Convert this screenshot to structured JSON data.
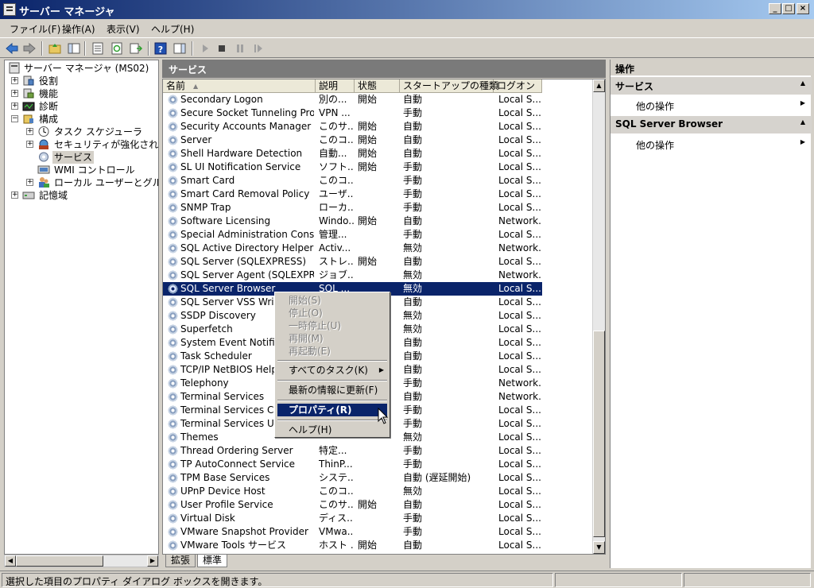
{
  "window": {
    "title": "サーバー マネージャ"
  },
  "menubar": [
    "ファイル(F)",
    "操作(A)",
    "表示(V)",
    "ヘルプ(H)"
  ],
  "tree": {
    "root": "サーバー マネージャ (MS02)",
    "roles": "役割",
    "features": "機能",
    "diagnostics": "診断",
    "config": "構成",
    "task_scheduler": "タスク スケジューラ",
    "firewall": "セキュリティが強化された Wi",
    "services": "サービス",
    "wmi": "WMI コントロール",
    "local_users": "ローカル ユーザーとグループ",
    "storage": "記憶域"
  },
  "center": {
    "header": "サービス",
    "columns": {
      "name": "名前",
      "desc": "説明",
      "status": "状態",
      "startup": "スタートアップの種類",
      "logon": "ログオン"
    },
    "rows": [
      {
        "name": "Secondary Logon",
        "desc": "別の...",
        "status": "開始",
        "startup": "自動",
        "logon": "Local S..."
      },
      {
        "name": "Secure Socket Tunneling Proto...",
        "desc": "VPN ...",
        "status": "",
        "startup": "手動",
        "logon": "Local S..."
      },
      {
        "name": "Security Accounts Manager",
        "desc": "このサ...",
        "status": "開始",
        "startup": "自動",
        "logon": "Local S..."
      },
      {
        "name": "Server",
        "desc": "このコ...",
        "status": "開始",
        "startup": "自動",
        "logon": "Local S..."
      },
      {
        "name": "Shell Hardware Detection",
        "desc": "自動...",
        "status": "開始",
        "startup": "自動",
        "logon": "Local S..."
      },
      {
        "name": "SL UI Notification Service",
        "desc": "ソフト...",
        "status": "開始",
        "startup": "手動",
        "logon": "Local S..."
      },
      {
        "name": "Smart Card",
        "desc": "このコ...",
        "status": "",
        "startup": "手動",
        "logon": "Local S..."
      },
      {
        "name": "Smart Card Removal Policy",
        "desc": "ユーザ...",
        "status": "",
        "startup": "手動",
        "logon": "Local S..."
      },
      {
        "name": "SNMP Trap",
        "desc": "ローカ...",
        "status": "",
        "startup": "手動",
        "logon": "Local S..."
      },
      {
        "name": "Software Licensing",
        "desc": "Windo...",
        "status": "開始",
        "startup": "自動",
        "logon": "Network..."
      },
      {
        "name": "Special Administration Console...",
        "desc": "管理...",
        "status": "",
        "startup": "手動",
        "logon": "Local S..."
      },
      {
        "name": "SQL Active Directory Helper S...",
        "desc": "Activ...",
        "status": "",
        "startup": "無効",
        "logon": "Network..."
      },
      {
        "name": "SQL Server (SQLEXPRESS)",
        "desc": "ストレ...",
        "status": "開始",
        "startup": "自動",
        "logon": "Local S..."
      },
      {
        "name": "SQL Server Agent (SQLEXPRE...",
        "desc": "ジョブ...",
        "status": "",
        "startup": "無効",
        "logon": "Network..."
      },
      {
        "name": "SQL Server Browser",
        "desc": "SQL ...",
        "status": "",
        "startup": "無効",
        "logon": "Local S..."
      },
      {
        "name": "SQL Server VSS Writer",
        "desc": "",
        "status": "",
        "startup": "自動",
        "logon": "Local S..."
      },
      {
        "name": "SSDP Discovery",
        "desc": "",
        "status": "",
        "startup": "無効",
        "logon": "Local S..."
      },
      {
        "name": "Superfetch",
        "desc": "",
        "status": "",
        "startup": "無効",
        "logon": "Local S..."
      },
      {
        "name": "System Event Notificat",
        "desc": "",
        "status": "",
        "startup": "自動",
        "logon": "Local S..."
      },
      {
        "name": "Task Scheduler",
        "desc": "",
        "status": "",
        "startup": "自動",
        "logon": "Local S..."
      },
      {
        "name": "TCP/IP NetBIOS Helpe",
        "desc": "",
        "status": "",
        "startup": "自動",
        "logon": "Local S..."
      },
      {
        "name": "Telephony",
        "desc": "",
        "status": "",
        "startup": "手動",
        "logon": "Network..."
      },
      {
        "name": "Terminal Services",
        "desc": "",
        "status": "",
        "startup": "自動",
        "logon": "Network..."
      },
      {
        "name": "Terminal Services Con",
        "desc": "",
        "status": "",
        "startup": "手動",
        "logon": "Local S..."
      },
      {
        "name": "Terminal Services User",
        "desc": "",
        "status": "",
        "startup": "手動",
        "logon": "Local S..."
      },
      {
        "name": "Themes",
        "desc": "",
        "status": "",
        "startup": "無効",
        "logon": "Local S..."
      },
      {
        "name": "Thread Ordering Server",
        "desc": "特定...",
        "status": "",
        "startup": "手動",
        "logon": "Local S..."
      },
      {
        "name": "TP AutoConnect Service",
        "desc": "ThinP...",
        "status": "",
        "startup": "手動",
        "logon": "Local S..."
      },
      {
        "name": "TPM Base Services",
        "desc": "システ...",
        "status": "",
        "startup": "自動 (遅延開始)",
        "logon": "Local S..."
      },
      {
        "name": "UPnP Device Host",
        "desc": "このコ...",
        "status": "",
        "startup": "無効",
        "logon": "Local S..."
      },
      {
        "name": "User Profile Service",
        "desc": "このサ...",
        "status": "開始",
        "startup": "自動",
        "logon": "Local S..."
      },
      {
        "name": "Virtual Disk",
        "desc": "ディス...",
        "status": "",
        "startup": "手動",
        "logon": "Local S..."
      },
      {
        "name": "VMware Snapshot Provider",
        "desc": "VMwa...",
        "status": "",
        "startup": "手動",
        "logon": "Local S..."
      },
      {
        "name": "VMware Tools サービス",
        "desc": "ホスト ...",
        "status": "開始",
        "startup": "自動",
        "logon": "Local S..."
      }
    ],
    "selected_row": "SQL Server Browser",
    "tabs": {
      "extended": "拡張",
      "standard": "標準"
    }
  },
  "context_menu": {
    "start": "開始(S)",
    "stop": "停止(O)",
    "pause": "一時停止(U)",
    "resume": "再開(M)",
    "restart": "再起動(E)",
    "all_tasks": "すべてのタスク(K)",
    "refresh": "最新の情報に更新(F)",
    "properties": "プロパティ(R)",
    "help": "ヘルプ(H)"
  },
  "actions": {
    "title": "操作",
    "section1": "サービス",
    "section1_item": "他の操作",
    "section2": "SQL Server Browser",
    "section2_item": "他の操作"
  },
  "status_bar": {
    "text": "選択した項目のプロパティ ダイアログ ボックスを開きます。"
  },
  "colors": {
    "selection": "#0a246a",
    "title_start": "#0a246a",
    "title_end": "#a6caf0",
    "panel_header": "#7a7a7a"
  }
}
